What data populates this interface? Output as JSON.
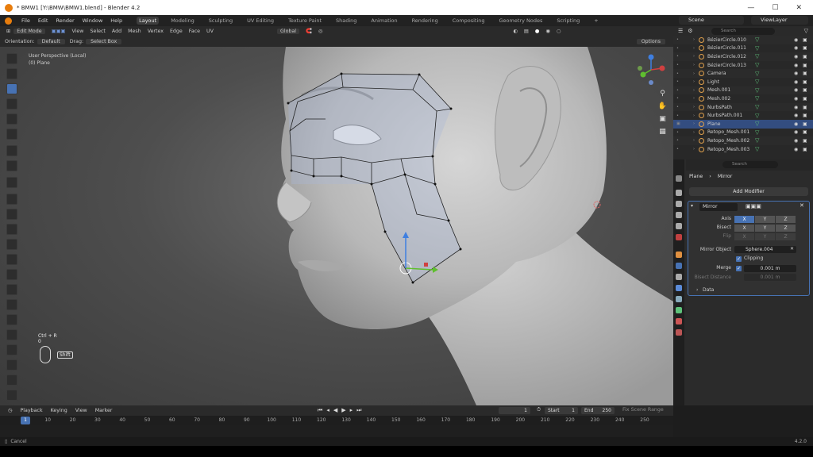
{
  "title": "* BMW1 [Y:\\BMW\\BMW1.blend] - Blender 4.2",
  "menus": [
    "File",
    "Edit",
    "Render",
    "Window",
    "Help"
  ],
  "workspaces": [
    "Layout",
    "Modeling",
    "Sculpting",
    "UV Editing",
    "Texture Paint",
    "Shading",
    "Animation",
    "Rendering",
    "Compositing",
    "Geometry Nodes",
    "Scripting"
  ],
  "active_workspace": "Layout",
  "scene": "Scene",
  "view_layer": "ViewLayer",
  "viewport_header": {
    "mode": "Edit Mode",
    "menus": [
      "View",
      "Select",
      "Add",
      "Mesh",
      "Vertex",
      "Edge",
      "Face",
      "UV"
    ],
    "transform": "Global",
    "orientation_label": "Orientation:",
    "orientation_value": "Default",
    "drag_label": "Drag:",
    "drag_value": "Select Box",
    "options": "Options"
  },
  "viewport_info": {
    "line1": "User Perspective (Local)",
    "line2": "(0) Plane"
  },
  "keyhint": {
    "combo": "Ctrl + R",
    "sub": "0",
    "key": "Shift"
  },
  "outliner": {
    "search_placeholder": "Search",
    "rows": [
      {
        "name": "BézierCircle.010",
        "color": "#e0a04c",
        "sel": false
      },
      {
        "name": "BézierCircle.011",
        "color": "#e0a04c",
        "sel": false
      },
      {
        "name": "BézierCircle.012",
        "color": "#e0a04c",
        "sel": false
      },
      {
        "name": "BézierCircle.013",
        "color": "#e0a04c",
        "sel": false
      },
      {
        "name": "Camera",
        "color": "#e0a04c",
        "sel": false
      },
      {
        "name": "Light",
        "color": "#e0a04c",
        "sel": false
      },
      {
        "name": "Mesh.001",
        "color": "#e0a04c",
        "sel": false
      },
      {
        "name": "Mesh.002",
        "color": "#e0a04c",
        "sel": false
      },
      {
        "name": "NurbsPath",
        "color": "#e0a04c",
        "sel": false
      },
      {
        "name": "NurbsPath.001",
        "color": "#e0a04c",
        "sel": false
      },
      {
        "name": "Plane",
        "color": "#e0a04c",
        "sel": true
      },
      {
        "name": "Retopo_Mesh.001",
        "color": "#e0a04c",
        "sel": false
      },
      {
        "name": "Retopo_Mesh.002",
        "color": "#e0a04c",
        "sel": false
      },
      {
        "name": "Retopo_Mesh.003",
        "color": "#e0a04c",
        "sel": false
      }
    ]
  },
  "properties": {
    "search_placeholder": "Search",
    "breadcrumb_object": "Plane",
    "breadcrumb_modifier": "Mirror",
    "add_modifier": "Add Modifier",
    "modifier_name": "Mirror",
    "axis_label": "Axis",
    "bisect_label": "Bisect",
    "flip_label": "Flip",
    "x": "X",
    "y": "Y",
    "z": "Z",
    "mirror_object_label": "Mirror Object",
    "mirror_object_value": "Sphere.004",
    "clipping_label": "Clipping",
    "merge_label": "Merge",
    "merge_value": "0.001 m",
    "bisect_distance_label": "Bisect Distance",
    "bisect_distance_value": "0.001 m",
    "data_label": "Data"
  },
  "timeline": {
    "menus": [
      "Playback",
      "Keying",
      "View",
      "Marker"
    ],
    "current_frame": "1",
    "start_label": "Start",
    "start_value": "1",
    "end_label": "End",
    "end_value": "250",
    "fix_range": "Fix Scene Range",
    "ticks": [
      "1",
      "10",
      "20",
      "30",
      "40",
      "50",
      "60",
      "70",
      "80",
      "90",
      "100",
      "110",
      "120",
      "130",
      "140",
      "150",
      "160",
      "170",
      "180",
      "190",
      "200",
      "210",
      "220",
      "230",
      "240",
      "250"
    ]
  },
  "status": {
    "left": "Cancel",
    "version": "4.2.0"
  }
}
